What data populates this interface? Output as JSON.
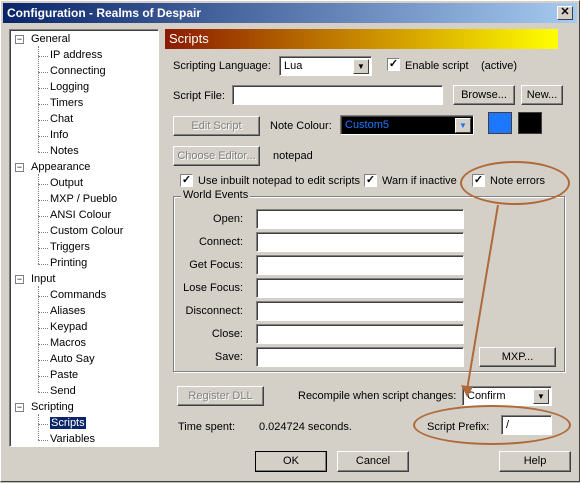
{
  "window": {
    "title": "Configuration - Realms of Despair",
    "close": "✕"
  },
  "tree": {
    "groups": [
      {
        "label": "General",
        "items": [
          "IP address",
          "Connecting",
          "Logging",
          "Timers",
          "Chat",
          "Info",
          "Notes"
        ]
      },
      {
        "label": "Appearance",
        "items": [
          "Output",
          "MXP / Pueblo",
          "ANSI Colour",
          "Custom Colour",
          "Triggers",
          "Printing"
        ]
      },
      {
        "label": "Input",
        "items": [
          "Commands",
          "Aliases",
          "Keypad",
          "Macros",
          "Auto Say",
          "Paste",
          "Send"
        ]
      },
      {
        "label": "Scripting",
        "items": [
          "Scripts",
          "Variables"
        ]
      }
    ],
    "selected": "Scripts",
    "expander": "−"
  },
  "panel": {
    "header": "Scripts",
    "scripting_language_label": "Scripting Language:",
    "scripting_language_value": "Lua",
    "enable_script_label": "Enable script",
    "enable_script_checked": "✓",
    "active_status": "(active)",
    "script_file_label": "Script File:",
    "script_file_value": "",
    "browse_button": "Browse...",
    "new_button": "New...",
    "edit_script_button": "Edit Script",
    "note_colour_label": "Note Colour:",
    "note_colour_value": "Custom5",
    "note_colour_swatch_1": "#1e78ff",
    "note_colour_swatch_2": "#000000",
    "choose_editor_button": "Choose Editor...",
    "editor_name": "notepad",
    "use_inbuilt_label": "Use inbuilt notepad to edit scripts",
    "warn_inactive_label": "Warn if inactive",
    "note_errors_label": "Note errors",
    "check_mark": "✓",
    "world_events": {
      "title": "World Events",
      "fields": [
        {
          "label": "Open:",
          "value": ""
        },
        {
          "label": "Connect:",
          "value": ""
        },
        {
          "label": "Get Focus:",
          "value": ""
        },
        {
          "label": "Lose Focus:",
          "value": ""
        },
        {
          "label": "Disconnect:",
          "value": ""
        },
        {
          "label": "Close:",
          "value": ""
        },
        {
          "label": "Save:",
          "value": ""
        }
      ],
      "mxp_button": "MXP..."
    },
    "register_dll_button": "Register DLL",
    "recompile_label": "Recompile when script changes:",
    "recompile_value": "Confirm",
    "time_spent_label": "Time spent:",
    "time_spent_value": "0.024724 seconds.",
    "script_prefix_label": "Script Prefix:",
    "script_prefix_value": "/",
    "annotation_color": "#b06a3a"
  },
  "footer": {
    "ok": "OK",
    "cancel": "Cancel",
    "help": "Help"
  },
  "arrow_glyph": "▼"
}
